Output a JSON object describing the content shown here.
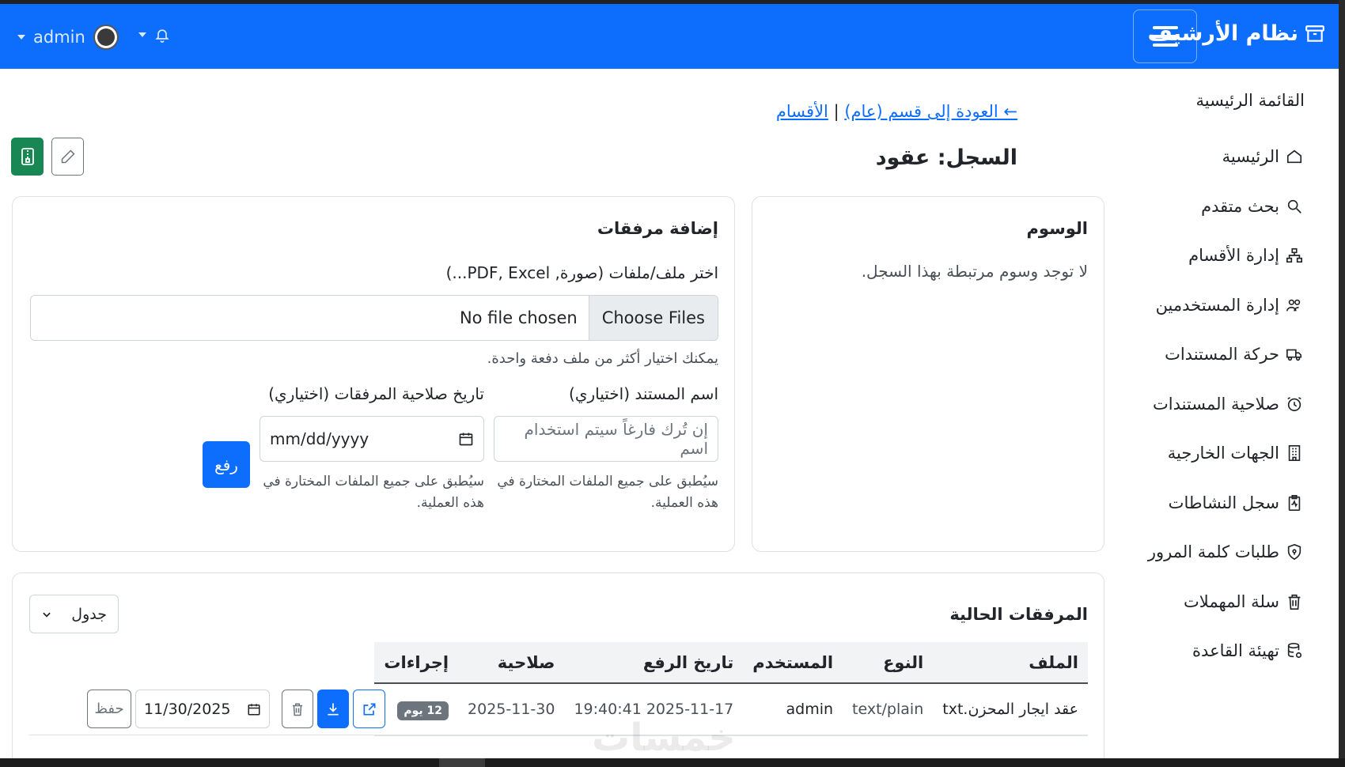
{
  "navbar": {
    "brand": "نظام الأرشيف",
    "user": "admin"
  },
  "sidebar": {
    "title": "القائمة الرئيسية",
    "items": [
      {
        "label": "الرئيسية"
      },
      {
        "label": "بحث متقدم"
      },
      {
        "label": "إدارة الأقسام"
      },
      {
        "label": "إدارة المستخدمين"
      },
      {
        "label": "حركة المستندات"
      },
      {
        "label": "صلاحية المستندات"
      },
      {
        "label": "الجهات الخارجية"
      },
      {
        "label": "سجل النشاطات"
      },
      {
        "label": "طلبات كلمة المرور"
      },
      {
        "label": "سلة المهملات"
      },
      {
        "label": "تهيئة القاعدة"
      }
    ]
  },
  "breadcrumb": {
    "back_link": "← العودة إلى قسم (عام)",
    "separator": "|",
    "sections_link": "الأقسام"
  },
  "page": {
    "title": "السجل: عقود"
  },
  "tags_card": {
    "title": "الوسوم",
    "empty": "لا توجد وسوم مرتبطة بهذا السجل."
  },
  "upload_card": {
    "title": "إضافة مرفقات",
    "file_label": "اختر ملف/ملفات (صورة, PDF, Excel...)",
    "choose_button": "Choose Files",
    "file_status": "No file chosen",
    "file_hint": "يمكنك اختيار أكثر من ملف دفعة واحدة.",
    "name_label": "اسم المستند (اختياري)",
    "name_placeholder": "إن تُرك فارغاً سيتم استخدام اسم",
    "name_hint": "سيُطبق على جميع الملفات المختارة في هذه العملية.",
    "expiry_label": "تاريخ صلاحية المرفقات (اختياري)",
    "expiry_placeholder": "mm/dd/yyyy",
    "expiry_hint": "سيُطبق على جميع الملفات المختارة في هذه العملية.",
    "upload_button": "رفع"
  },
  "files_card": {
    "title": "المرفقات الحالية",
    "view_select": "جدول",
    "columns": [
      "الملف",
      "النوع",
      "المستخدم",
      "تاريخ الرفع",
      "صلاحية",
      "إجراءات"
    ],
    "rows": [
      {
        "file": "عقد ايجار المحزن.txt",
        "type": "text/plain",
        "user": "admin",
        "uploaded": "2025-11-17 19:40:41",
        "expiry": "2025-11-30",
        "badge": "12 يوم",
        "date_value": "11/30/2025",
        "save_label": "حفظ"
      }
    ]
  },
  "watermark": "خمسات"
}
